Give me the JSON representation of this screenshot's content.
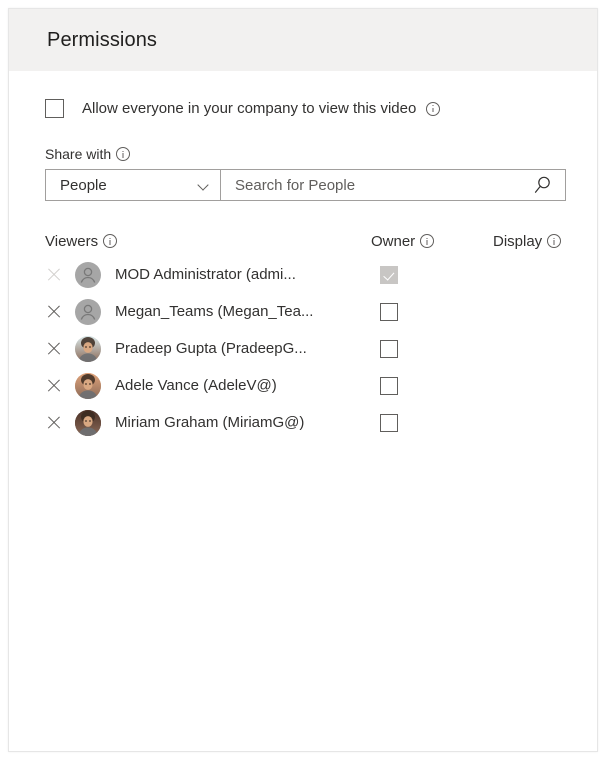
{
  "panel": {
    "title": "Permissions"
  },
  "allow_everyone": {
    "label": "Allow everyone in your company to view this video",
    "checked": false
  },
  "share_with": {
    "label": "Share with",
    "select_value": "People",
    "select_options": [
      "People"
    ],
    "search_placeholder": "Search for People",
    "search_value": ""
  },
  "table": {
    "headers": {
      "viewers": "Viewers",
      "owner": "Owner",
      "display": "Display"
    },
    "rows": [
      {
        "name": "MOD Administrator (admi...",
        "avatar_type": "person-glyph",
        "avatar_color": "#a6a6a6",
        "owner_checked": true,
        "owner_disabled": true,
        "remove_disabled": true
      },
      {
        "name": "Megan_Teams (Megan_Tea...",
        "avatar_type": "person-glyph",
        "avatar_color": "#a6a6a6",
        "owner_checked": false,
        "owner_disabled": false,
        "remove_disabled": false
      },
      {
        "name": "Pradeep Gupta (PradeepG...",
        "avatar_type": "photo",
        "avatar_color": "#d9e7e8",
        "owner_checked": false,
        "owner_disabled": false,
        "remove_disabled": false
      },
      {
        "name": "Adele Vance (AdeleV@)",
        "avatar_type": "photo",
        "avatar_color": "#e0a37a",
        "owner_checked": false,
        "owner_disabled": false,
        "remove_disabled": false
      },
      {
        "name": "Miriam Graham (MiriamG@)",
        "avatar_type": "photo",
        "avatar_color": "#4a3026",
        "owner_checked": false,
        "owner_disabled": false,
        "remove_disabled": false
      }
    ]
  },
  "colors": {
    "header_band": "#f2f1f0",
    "text": "#323130",
    "border": "#a19f9d",
    "disabled_fill": "#c8c6c4"
  }
}
